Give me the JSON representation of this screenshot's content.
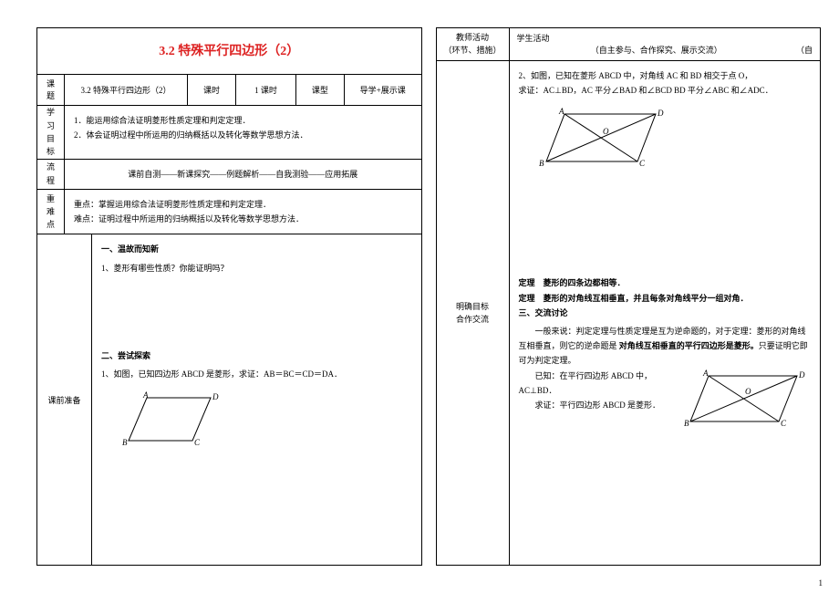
{
  "title": "3.2 特殊平行四边形（2）",
  "meta": {
    "topic_label1": "课",
    "topic_label2": "题",
    "topic_value": "3.2 特殊平行四边形（2）",
    "period_label": "课时",
    "period_value": "1 课时",
    "type_label": "课型",
    "type_value": "导学+展示课"
  },
  "objective": {
    "label1": "学",
    "label2": "习",
    "label3": "目",
    "label4": "标",
    "line1": "1．能运用综合法证明菱形性质定理和判定定理．",
    "line2": "2．体会证明过程中所运用的归纳概括以及转化等数学思想方法．"
  },
  "flow": {
    "label1": "流",
    "label2": "程",
    "text": "课前自测——新课探究——例题解析——自我测验——应用拓展"
  },
  "keydiff": {
    "label1": "重",
    "label2": "难",
    "label3": "点",
    "line1": "重点：掌握运用综合法证明菱形性质定理和判定定理．",
    "line2": "难点：证明过程中所运用的归纳概括以及转化等数学思想方法．"
  },
  "prep": {
    "label": "课前准备",
    "s1_head": "一、温故而知新",
    "s1_q1": "1、菱形有哪些性质？你能证明吗？",
    "s2_head": "二、尝试探索",
    "s2_q1": "1、如图，已知四边形 ABCD 是菱形，求证：AB＝BC＝CD＝DA．"
  },
  "right": {
    "col1_l1": "教师活动",
    "col1_l2": "（环节、措施）",
    "col2_l1": "学生活动",
    "col2_l2": "（自主参与、合作探究、展示交流）",
    "q2": "2、如图，已知在菱形 ABCD 中，对角线 AC 和 BD 相交于点 O，",
    "q2b": "求证：AC⊥BD，AC 平分∠BAD 和∠BCD  BD 平分∠ABC 和∠ADC．",
    "side_l1": "明确目标",
    "side_l2": "合作交流",
    "theorem1_label": "定理",
    "theorem1": "菱形的四条边都相等．",
    "theorem2_label": "定理",
    "theorem2": "菱形的对角线互相垂直，并且每条对角线平分一组对角．",
    "s3_head": "三、交流讨论",
    "discuss1": "一般来说：判定定理与性质定理是互为逆命题的，对于定理：菱形的对角线互相垂直，则它的逆命题是",
    "discuss1_key": "对角线互相垂直的平行四边形是菱形。",
    "discuss1_tail": "只要证明它即可为判定定理。",
    "given": "已知：在平行四边形 ABCD 中，AC⊥BD．",
    "prove": "求证：平行四边形 ABCD 是菱形．"
  },
  "page_number": "1",
  "partial_text": "（自"
}
